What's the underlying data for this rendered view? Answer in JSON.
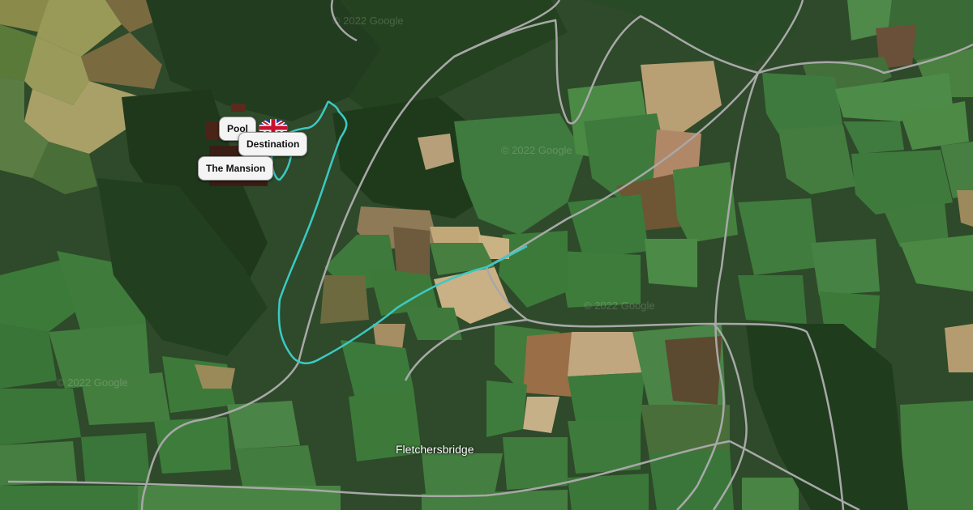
{
  "map": {
    "place_label": "Fletchersbridge",
    "watermarks": [
      "© 2022 Google",
      "© 2022 Google",
      "© 2022 Google",
      "© 2022 Google"
    ],
    "route_color": "#3cc9c4",
    "markers": [
      {
        "label": "Pool"
      },
      {
        "label": "Destination"
      },
      {
        "label": "The Mansion"
      }
    ],
    "flag_icon": "union-jack-flag-icon"
  }
}
